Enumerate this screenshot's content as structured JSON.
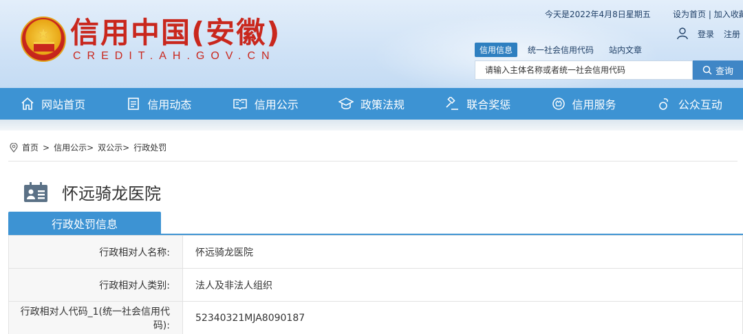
{
  "header": {
    "site_title": "信用中国(安徽)",
    "site_subtitle": "CREDIT.AH.GOV.CN",
    "today": "今天是2022年4月8日星期五",
    "top_links": {
      "set_home": "设为首页",
      "separator": "|",
      "bookmark": "加入收藏"
    },
    "login": "登录",
    "register": "注册",
    "search_tabs": [
      "信用信息",
      "统一社会信用代码",
      "站内文章"
    ],
    "search_placeholder": "请输入主体名称或者统一社会信用代码",
    "search_button": "查询"
  },
  "nav": {
    "items": [
      {
        "label": "网站首页",
        "icon": "home-icon"
      },
      {
        "label": "信用动态",
        "icon": "document-icon"
      },
      {
        "label": "信用公示",
        "icon": "open-book-icon"
      },
      {
        "label": "政策法规",
        "icon": "graduation-cap-icon"
      },
      {
        "label": "联合奖惩",
        "icon": "gavel-icon"
      },
      {
        "label": "信用服务",
        "icon": "badge-icon"
      },
      {
        "label": "公众互动",
        "icon": "chat-icon"
      }
    ]
  },
  "breadcrumb": {
    "home": "首页",
    "sep1": ">",
    "level1": "信用公示>",
    "level2": "双公示>",
    "current": "行政处罚"
  },
  "entity": {
    "name": "怀远骑龙医院"
  },
  "section": {
    "tab_label": "行政处罚信息",
    "rows": [
      {
        "label": "行政相对人名称:",
        "value": "怀远骑龙医院"
      },
      {
        "label": "行政相对人类别:",
        "value": "法人及非法人组织"
      },
      {
        "label": "行政相对人代码_1(统一社会信用代码):",
        "value": "52340321MJA8090187"
      }
    ]
  },
  "colors": {
    "brand_red": "#c9271d",
    "nav_blue": "#3d93d3",
    "button_blue": "#3f86c6"
  }
}
